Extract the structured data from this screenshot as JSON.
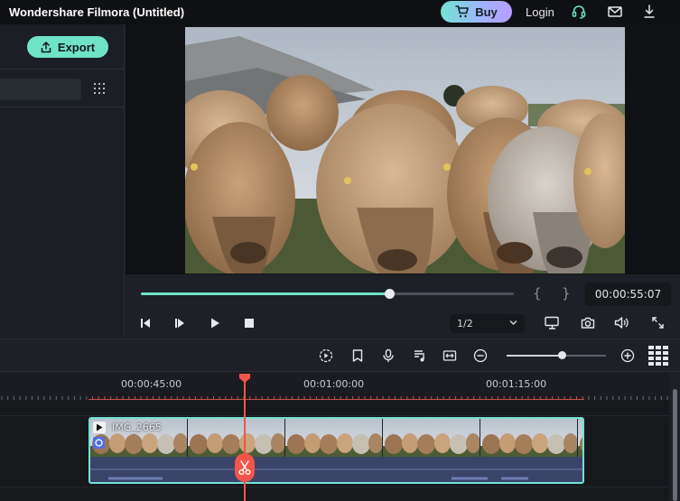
{
  "window": {
    "title": "Wondershare Filmora (Untitled)"
  },
  "header": {
    "buy_label": "Buy",
    "login_label": "Login",
    "icons": [
      "cart-icon",
      "headset-icon",
      "mail-icon",
      "download-icon"
    ]
  },
  "left_panel": {
    "export_label": "Export",
    "search_value": "",
    "icons": [
      "export-icon",
      "grid-icon"
    ]
  },
  "player": {
    "progress": 0.665,
    "mark_in": "{",
    "mark_out": "}",
    "timecode": "00:00:55:07",
    "zoom_value": "1/2",
    "icons": [
      "step-back-icon",
      "step-forward-icon",
      "play-icon",
      "stop-icon",
      "monitor-icon",
      "snapshot-icon",
      "volume-icon",
      "fullscreen-icon"
    ]
  },
  "timeline_toolbar": {
    "icons": [
      "render-preview-icon",
      "marker-icon",
      "voiceover-icon",
      "audio-mixer-icon",
      "fit-icon",
      "zoom-out-icon",
      "zoom-in-icon",
      "grid-view-icon"
    ],
    "zoom_level": 0.55
  },
  "ruler": {
    "labels": [
      "00:00:45:00",
      "00:01:00:00",
      "00:01:15:00"
    ]
  },
  "clip": {
    "name": "IMG_2665"
  },
  "colors": {
    "accent": "#6fe3c7",
    "playhead": "#f2564a",
    "clip_border": "#6fe3d3",
    "clip_audio": "#3a4368"
  }
}
